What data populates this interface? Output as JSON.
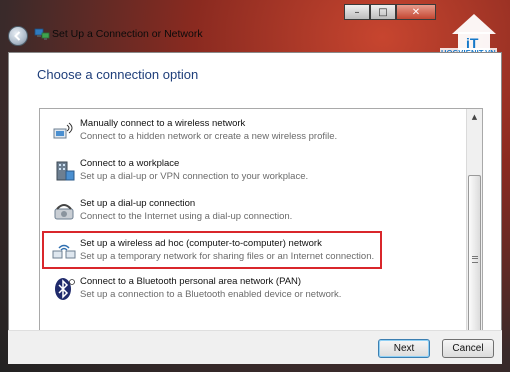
{
  "window": {
    "title": "Set Up a Connection or Network",
    "buttons": [
      "–",
      "□",
      "✕"
    ]
  },
  "watermark": {
    "text": "HOCVIENIT.VN"
  },
  "main": {
    "heading": "Choose a connection option",
    "options": [
      {
        "title": "Manually connect to a wireless network",
        "desc": "Connect to a hidden network or create a new wireless profile.",
        "icon": "wireless-network-icon"
      },
      {
        "title": "Connect to a workplace",
        "desc": "Set up a dial-up or VPN connection to your workplace.",
        "icon": "workplace-icon"
      },
      {
        "title": "Set up a dial-up connection",
        "desc": "Connect to the Internet using a dial-up connection.",
        "icon": "dial-up-icon"
      },
      {
        "title": "Set up a wireless ad hoc (computer-to-computer) network",
        "desc": "Set up a temporary network for sharing files or an Internet connection.",
        "icon": "ad-hoc-network-icon"
      },
      {
        "title": "Connect to a Bluetooth personal area network (PAN)",
        "desc": "Set up a connection to a Bluetooth enabled device or network.",
        "icon": "bluetooth-icon"
      }
    ]
  },
  "footer": {
    "next_label": "Next",
    "cancel_label": "Cancel"
  },
  "colors": {
    "heading": "#1e3e7a",
    "highlight": "#d9262b",
    "accent": "#3c7fb1"
  }
}
